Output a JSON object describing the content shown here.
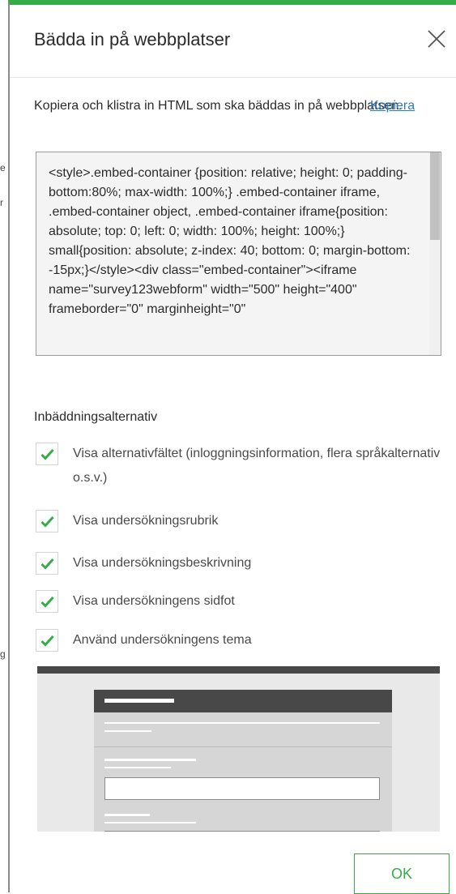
{
  "dialog": {
    "title": "Bädda in på webbplatser",
    "close_icon": "close-icon",
    "intro": "Kopiera och klistra in HTML som ska bäddas in på webbplatsen.",
    "copy_label": "Kopiera",
    "embed_code": "<style>.embed-container {position: relative; height: 0; padding-bottom:80%; max-width: 100%;} .embed-container iframe, .embed-container object, .embed-container iframe{position: absolute; top: 0; left: 0; width: 100%; height: 100%;} small{position: absolute; z-index: 40; bottom: 0; margin-bottom: -15px;}</style><div class=\"embed-container\"><iframe name=\"survey123webform\" width=\"500\" height=\"400\" frameborder=\"0\" marginheight=\"0\"",
    "options_title": "Inbäddningsalternativ",
    "options": [
      {
        "label": "Visa alternativfältet (inloggningsinformation, flera språkalternativ o.s.v.)",
        "checked": true
      },
      {
        "label": "Visa undersökningsrubrik",
        "checked": true
      },
      {
        "label": "Visa undersökningsbeskrivning",
        "checked": true
      },
      {
        "label": "Visa undersökningens sidfot",
        "checked": true
      },
      {
        "label": "Använd undersökningens tema",
        "checked": true
      }
    ],
    "ok_label": "OK"
  },
  "colors": {
    "accent": "#35ac46",
    "link": "#2f7bbd",
    "preview_header": "#484848"
  }
}
